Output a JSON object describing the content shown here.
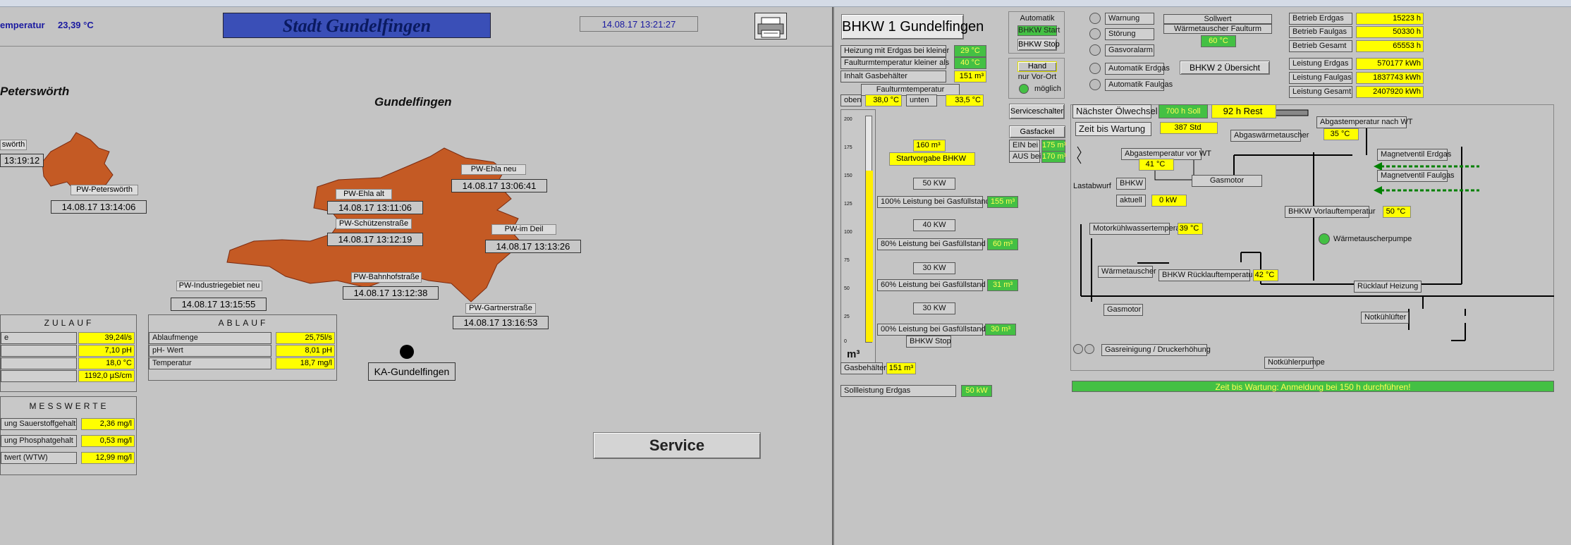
{
  "left": {
    "temp_label": "emperatur",
    "temp_value": "23,39 °C",
    "city_title": "Stadt Gundelfingen",
    "datetime": "14.08.17 13:21:27",
    "region_peterswoerth": "Peterswörth",
    "region_gundelfingen": "Gundelfingen",
    "stations": [
      {
        "name": "swörth",
        "time": "13:19:12"
      },
      {
        "name": "PW-Peterswörth",
        "time": "14.08.17 13:14:06"
      },
      {
        "name": "PW-Ehla alt",
        "time": "14.08.17 13:11:06"
      },
      {
        "name": "PW-Schützenstraße",
        "time": "14.08.17 13:12:19"
      },
      {
        "name": "PW-Ehla neu",
        "time": "14.08.17 13:06:41"
      },
      {
        "name": "PW-im Deil",
        "time": "14.08.17 13:13:26"
      },
      {
        "name": "PW-Bahnhofstraße",
        "time": "14.08.17 13:12:38"
      },
      {
        "name": "PW-Industriegebiet neu",
        "time": "14.08.17 13:15:55"
      },
      {
        "name": "PW-Gartnerstraße",
        "time": "14.08.17 13:16:53"
      }
    ],
    "zulauf": {
      "title": "ZULAUF",
      "rows": [
        {
          "label": "e",
          "value": "39,24l/s"
        },
        {
          "label": "",
          "value": "7,10 pH"
        },
        {
          "label": "",
          "value": "18,0 °C"
        },
        {
          "label": "",
          "value": "1192,0 µS/cm"
        }
      ]
    },
    "ablauf": {
      "title": "ABLAUF",
      "rows": [
        {
          "label": "Ablaufmenge",
          "value": "25,75l/s"
        },
        {
          "label": "pH- Wert",
          "value": "8,01 pH"
        },
        {
          "label": "Temperatur",
          "value": "18,7 mg/l"
        }
      ]
    },
    "messwerte": {
      "title": "MESSWERTE",
      "rows": [
        {
          "label": "ung Sauerstoffgehalt",
          "value": "2,36 mg/l"
        },
        {
          "label": "ung Phosphatgehalt",
          "value": "0,53 mg/l"
        },
        {
          "label": "twert (WTW)",
          "value": "12,99 mg/l"
        }
      ]
    },
    "ka_label": "KA-Gundelfingen",
    "service_label": "Service"
  },
  "right": {
    "title": "BHKW 1 Gundelfingen",
    "params": [
      {
        "label": "Heizung mit Erdgas bei kleiner",
        "value": "29 °C"
      },
      {
        "label": "Faulturmtemperatur kleiner als",
        "value": "40 °C"
      },
      {
        "label": "Inhalt Gasbehälter",
        "value": "151 m³"
      }
    ],
    "faulturm_label": "Faulturmtemperatur",
    "oben_label": "oben",
    "oben_value": "38,0 °C",
    "unten_label": "unten",
    "unten_value": "33,5 °C",
    "mode": {
      "automatik": "Automatik",
      "bhkw_start": "BHKW Start",
      "bhkw_stop": "BHKW Stop",
      "hand": "Hand",
      "nur_vor_ort": "nur Vor-Ort",
      "moeglich": "möglich"
    },
    "serviceschalter": "Serviceschalter",
    "gasfackel": {
      "title": "Gasfackel",
      "ein_label": "EIN  bei",
      "ein_value": "175 m³",
      "aus_label": "AUS  bei",
      "aus_value": "170 m³"
    },
    "alarms": [
      "Warnung",
      "Störung",
      "Gasvoralarm",
      "Automatik Erdgas",
      "Automatik Faulgas"
    ],
    "sollwert": {
      "title": "Sollwert",
      "subtitle": "Wärmetauscher Faulturm",
      "value": "60 °C"
    },
    "bhkw2": "BHKW 2 Übersicht",
    "betrieb": [
      {
        "label": "Betrieb Erdgas",
        "value": "15223 h"
      },
      {
        "label": "Betrieb Faulgas",
        "value": "50330 h"
      },
      {
        "label": "Betrieb Gesamt",
        "value": "65553 h"
      },
      {
        "label": "Leistung Erdgas",
        "value": "570177 kWh"
      },
      {
        "label": "Leistung Faulgas",
        "value": "1837743 kWh"
      },
      {
        "label": "Leistung Gesamt",
        "value": "2407920 kWh"
      }
    ],
    "gauge_ticks": [
      "200",
      "175",
      "150",
      "125",
      "100",
      "75",
      "50",
      "25",
      "0"
    ],
    "gauge_unit": "m³",
    "gauge_fill_fraction": 0.76,
    "startvorgabe_value": "160 m³",
    "startvorgabe_label": "Startvorgabe BHKW",
    "levels": [
      {
        "kw": "50 KW",
        "label": "100% Leistung bei Gasfüllstand",
        "value": "155 m³"
      },
      {
        "kw": "40 KW",
        "label": "80% Leistung bei Gasfüllstand",
        "value": "60 m³"
      },
      {
        "kw": "30 KW",
        "label": "60% Leistung bei Gasfüllstand",
        "value": "31 m³"
      },
      {
        "kw": "30 KW",
        "label": "00% Leistung bei Gasfüllstand",
        "value": "30 m³"
      }
    ],
    "bhkw_stop2": "BHKW Stop",
    "gasbehaelter_label": "Gasbehälter",
    "gasbehaelter_value": "151 m³",
    "sollleistung_label": "Sollleistung Erdgas",
    "sollleistung_value": "50 kW",
    "oelwechsel_label": "Nächster Ölwechsel",
    "oelwechsel_soll": "700 h Soll",
    "oelwechsel_rest": "92 h Rest",
    "wartung_label": "Zeit bis Wartung",
    "wartung_value": "387 Std",
    "abgaswt": "Abgaswärmetauscher",
    "abgastemp_nach_label": "Abgastemperatur nach WT",
    "abgastemp_nach_value": "35 °C",
    "abgastemp_vor_label": "Abgastemperatur vor WT",
    "abgastemp_vor_value": "41 °C",
    "magnet_erdgas": "Magnetventil Erdgas",
    "magnet_faulgas": "Magnetventil Faulgas",
    "lastabwurf": "Lastabwurf",
    "bhkw_box": "BHKW",
    "gasmotor": "Gasmotor",
    "aktuell_label": "aktuell",
    "aktuell_value": "0 kW",
    "vorlauf_label": "BHKW Vorlauftemperatur",
    "vorlauf_value": "50 °C",
    "motorkuehl_label": "Motorkühlwassertemperatur",
    "motorkuehl_value": "39 °C",
    "waermetauscherpumpe": "Wärmetauscherpumpe",
    "waermetauscher": "Wärmetauscher",
    "ruecklauf_label": "BHKW Rücklauftemperatur",
    "ruecklauf_value": "42 °C",
    "ruecklauf_heizung": "Rücklauf Heizung",
    "gasmotor2": "Gasmotor",
    "notkuehler": "Notkühlüfter",
    "gasreinigung": "Gasreinigung / Druckerhöhung",
    "notkuehlpumpe": "Notkühlerpumpe",
    "wartung_banner": "Zeit bis Wartung: Anmeldung bei 150 h durchführen!"
  }
}
